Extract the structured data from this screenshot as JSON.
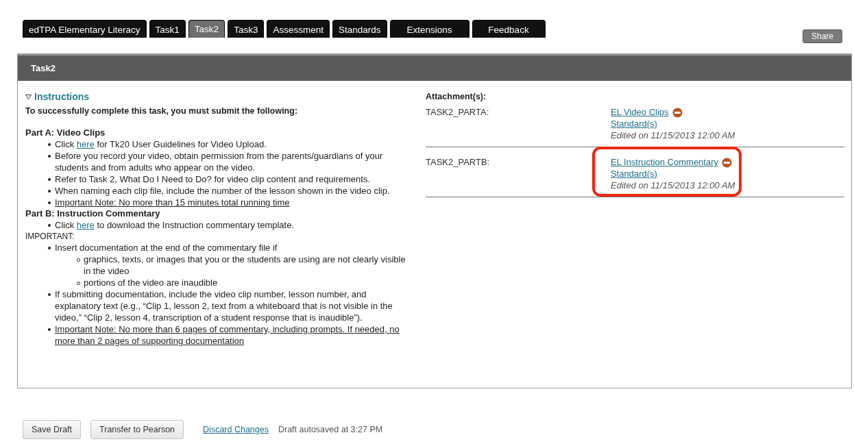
{
  "tabs": [
    {
      "label": "edTPA Elementary Literacy",
      "selected": false
    },
    {
      "label": "Task1",
      "selected": false
    },
    {
      "label": "Task2",
      "selected": true
    },
    {
      "label": "Task3",
      "selected": false
    },
    {
      "label": "Assessment",
      "selected": false
    },
    {
      "label": "Standards",
      "selected": false
    },
    {
      "label": "Extensions",
      "selected": false
    },
    {
      "label": "Feedback",
      "selected": false
    }
  ],
  "share_button": "Share",
  "panel": {
    "title": "Task2",
    "instructions": {
      "toggle_label": "Instructions",
      "expanded": true,
      "intro": "To successfully complete this task, you must submit the following:",
      "sections": [
        {
          "heading": "Part A: Video Clips",
          "kind": "bold",
          "items": [
            {
              "before": "Click ",
              "link": "here",
              "after": " for Tk20 User Guidelines for Video Upload.",
              "underlined": false
            },
            {
              "before": "Before you record your video, obtain permission from the parents/guardians of your students and from adults who appear on the video.",
              "underlined": false
            },
            {
              "before": "Refer to Task 2, What Do I Need to Do? for video clip content and requirements.",
              "underlined": false
            },
            {
              "before": "When naming each clip file, include the number of the lesson shown in the video clip.",
              "underlined": false
            },
            {
              "before": "Important Note: No more than 15 minutes total running time",
              "underlined": true
            }
          ]
        },
        {
          "heading": "Part B: Instruction Commentary",
          "kind": "bold",
          "items": [
            {
              "before": "Click ",
              "link": "here",
              "after": " to download the Instruction commentary template.",
              "underlined": false
            }
          ]
        },
        {
          "heading": "IMPORTANT:",
          "kind": "plain",
          "items": [
            {
              "before": "Insert documentation at the end of the commentary file if",
              "underlined": false,
              "children": [
                {
                  "before": "graphics, texts, or images that you or the students are using are not clearly visible in the video",
                  "underlined": false
                },
                {
                  "before": "portions of the video are inaudible",
                  "underlined": false
                }
              ]
            },
            {
              "before": "If submitting documentation, include the video clip number, lesson number, and explanatory text (e.g., “Clip 1, lesson 2, text from a whiteboard that is not visible in the video,” “Clip 2, lesson 4, transcription of a student response that is inaudible”).",
              "underlined": false
            },
            {
              "before": "Important Note: No more than 6 pages of commentary, including prompts. If needed, no more than 2 pages of supporting documentation",
              "underlined": true
            }
          ]
        }
      ]
    },
    "attachments_heading": "Attachment(s):",
    "attachments": [
      {
        "label": "TASK2_PARTA:",
        "file": "EL Video Clips",
        "standards": "Standard(s)",
        "edited": "Edited on 11/15/2013 12:00 AM",
        "highlighted": false
      },
      {
        "label": "TASK2_PARTB:",
        "file": "EL Instruction Commentary",
        "standards": "Standard(s)",
        "edited": "Edited on 11/15/2013 12:00 AM",
        "highlighted": true
      }
    ]
  },
  "footer": {
    "buttons": [
      "Save Draft",
      "Transfer to Pearson"
    ],
    "discard_link": "Discard Changes",
    "autosave_status": "Draft autosaved at 3:27 PM"
  }
}
